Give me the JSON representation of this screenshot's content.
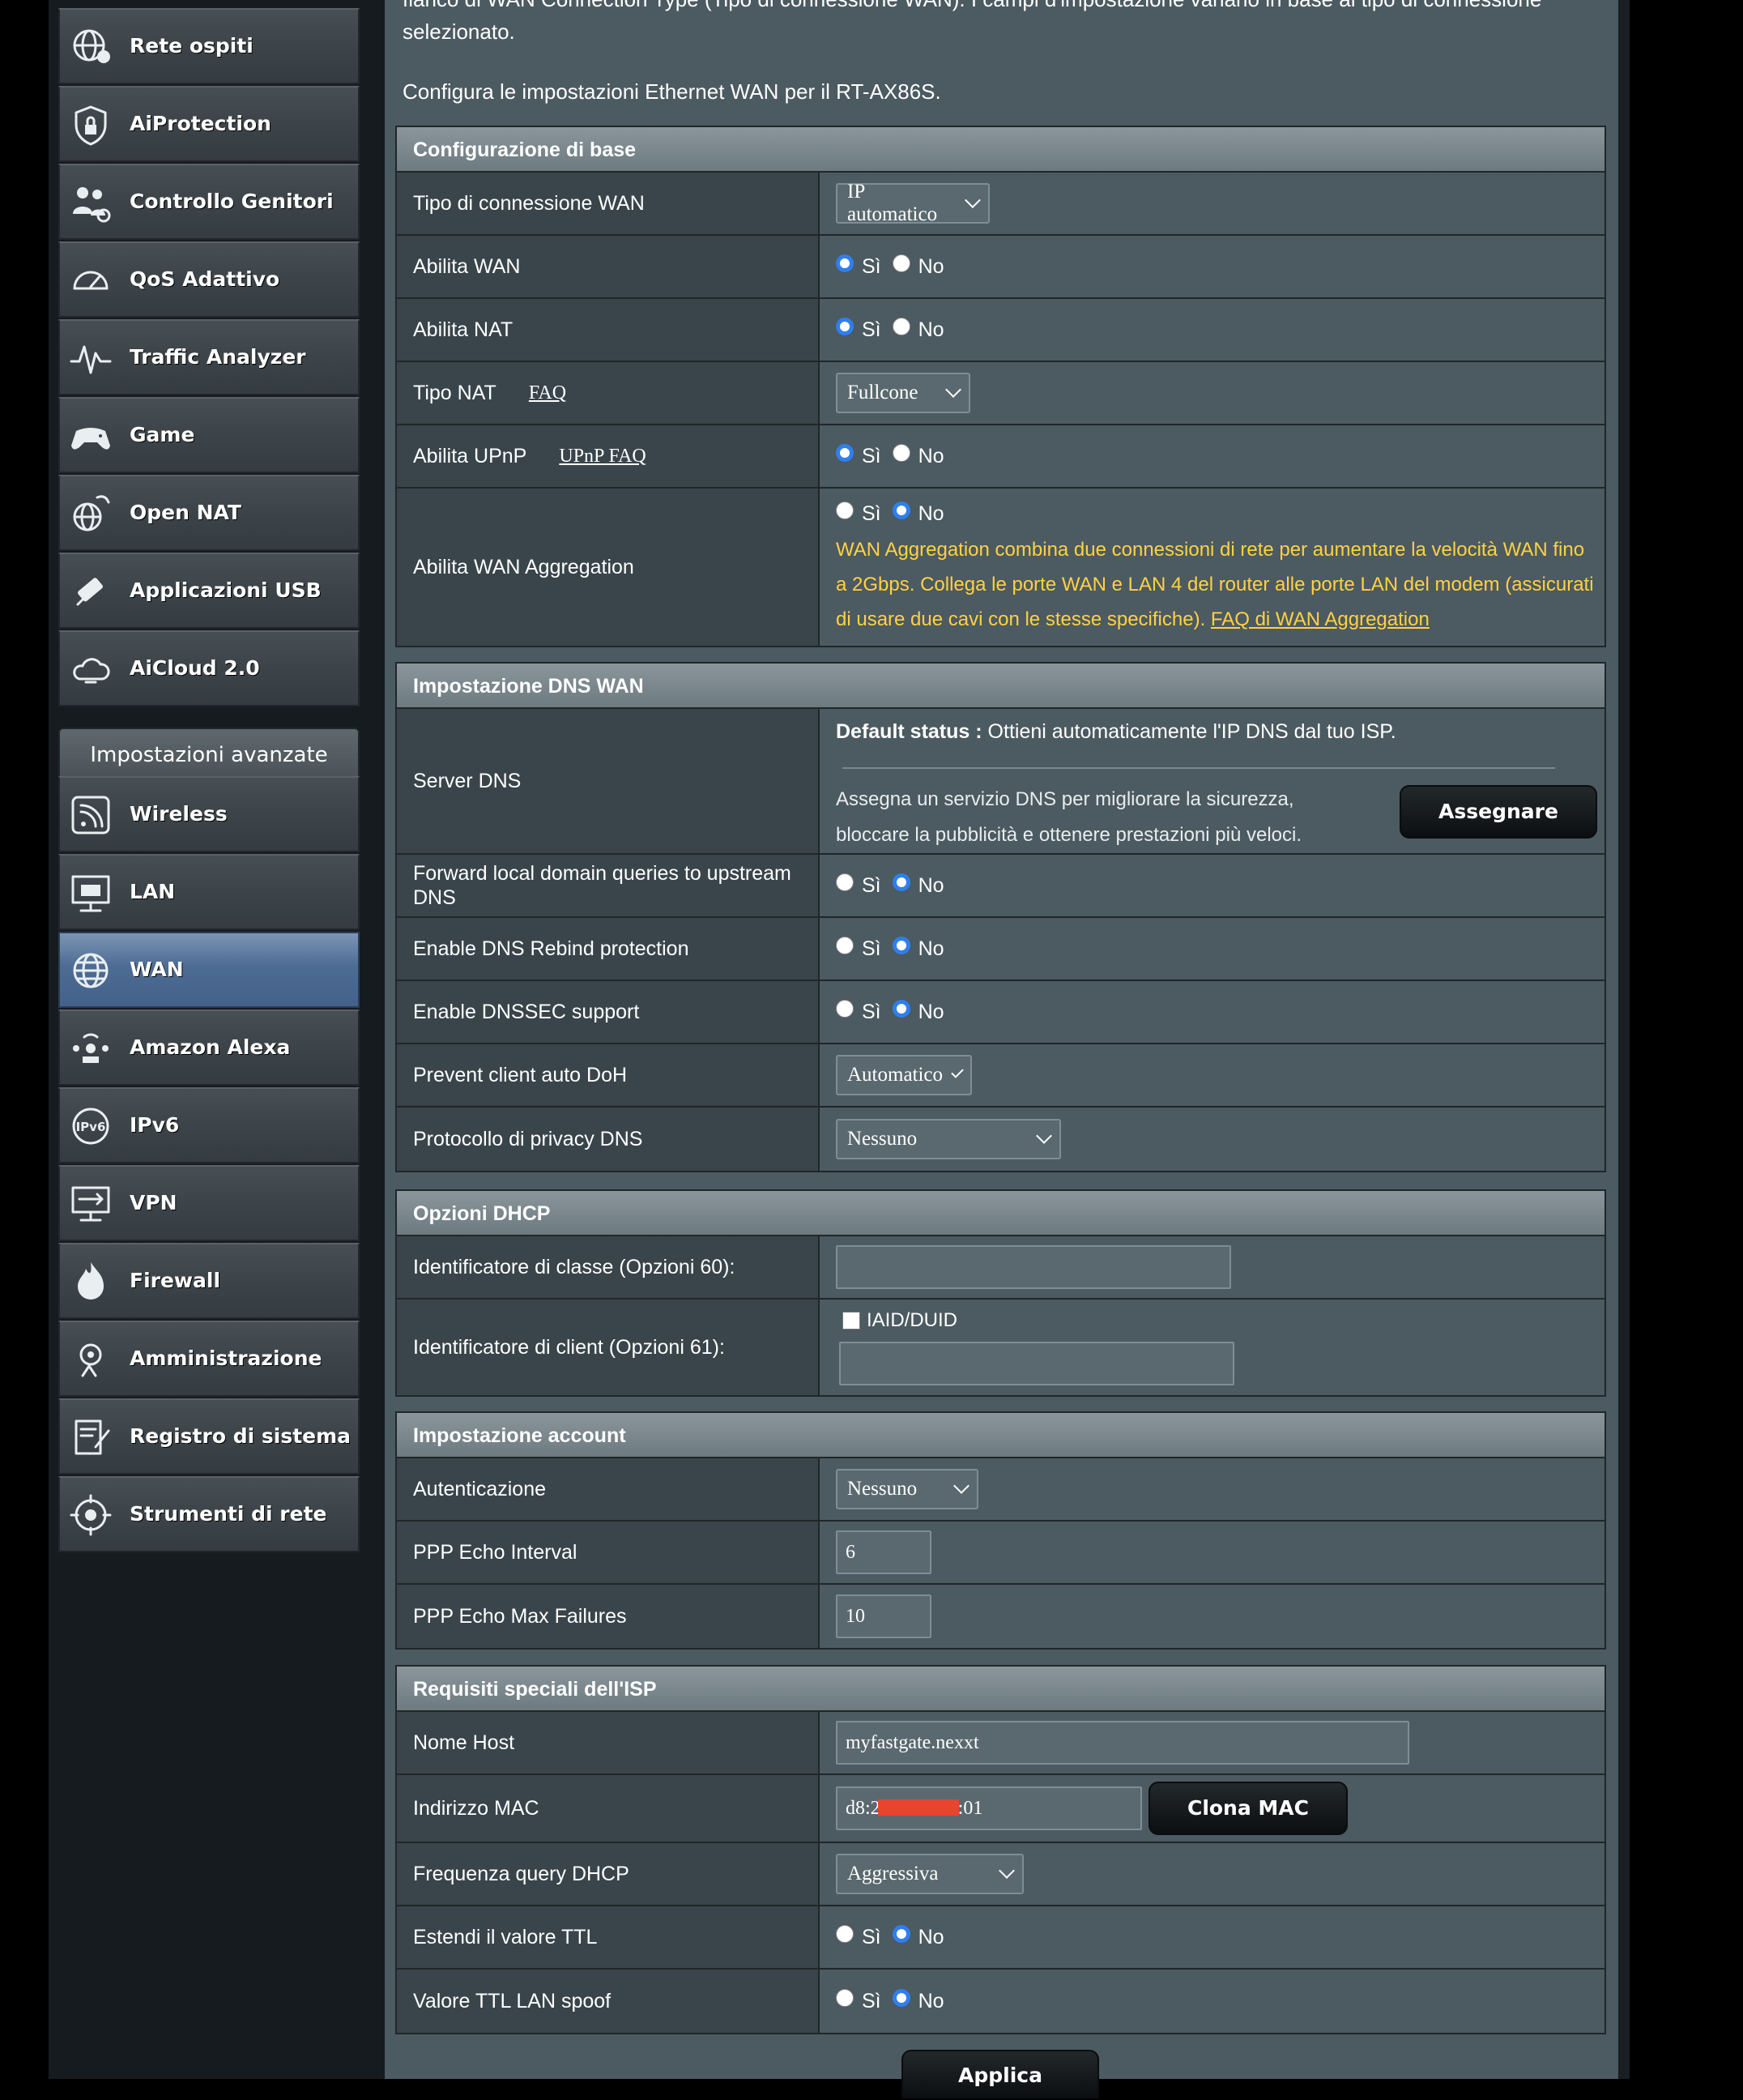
{
  "sidebar": {
    "items": [
      {
        "label": "Rete ospiti",
        "icon": "guest-network-icon"
      },
      {
        "label": "AiProtection",
        "icon": "shield-lock-icon"
      },
      {
        "label": "Controllo Genitori",
        "icon": "parental-control-icon"
      },
      {
        "label": "QoS Adattivo",
        "icon": "speedometer-icon"
      },
      {
        "label": "Traffic Analyzer",
        "icon": "traffic-analyzer-icon"
      },
      {
        "label": "Game",
        "icon": "gamepad-icon"
      },
      {
        "label": "Open NAT",
        "icon": "open-nat-icon"
      },
      {
        "label": "Applicazioni USB",
        "icon": "usb-icon"
      },
      {
        "label": "AiCloud 2.0",
        "icon": "cloud-icon"
      }
    ],
    "advanced_header": "Impostazioni avanzate",
    "advanced_items": [
      {
        "label": "Wireless",
        "icon": "wireless-icon"
      },
      {
        "label": "LAN",
        "icon": "lan-icon"
      },
      {
        "label": "WAN",
        "icon": "globe-icon",
        "active": true
      },
      {
        "label": "Amazon Alexa",
        "icon": "alexa-icon"
      },
      {
        "label": "IPv6",
        "icon": "ipv6-icon"
      },
      {
        "label": "VPN",
        "icon": "vpn-icon"
      },
      {
        "label": "Firewall",
        "icon": "firewall-icon"
      },
      {
        "label": "Amministrazione",
        "icon": "administration-icon"
      },
      {
        "label": "Registro di sistema",
        "icon": "system-log-icon"
      },
      {
        "label": "Strumenti di rete",
        "icon": "network-tools-icon"
      }
    ]
  },
  "intro": {
    "line1": "fianco di WAN Connection Type (Tipo di connessione WAN). I campi d'impostazione variano in base al tipo di connessione",
    "line2": "selezionato.",
    "line3": "Configura le impostazioni Ethernet WAN per il RT-AX86S."
  },
  "radio": {
    "yes": "Sì",
    "no": "No"
  },
  "basic": {
    "title": "Configurazione di base",
    "wan_type_label": "Tipo di connessione WAN",
    "wan_type_value": "IP automatico",
    "enable_wan_label": "Abilita WAN",
    "enable_nat_label": "Abilita NAT",
    "nat_type_label": "Tipo NAT",
    "nat_type_faq": "FAQ",
    "nat_type_value": "Fullcone",
    "upnp_label": "Abilita UPnP",
    "upnp_faq": "UPnP FAQ",
    "aggregation_label": "Abilita WAN Aggregation",
    "aggregation_note": "WAN Aggregation combina due connessioni di rete per aumentare la velocità WAN fino a 2Gbps. Collega le porte WAN e LAN 4 del router alle porte LAN del modem (assicurati di usare due cavi con le stesse specifiche).",
    "aggregation_faq": "FAQ di WAN Aggregation"
  },
  "dns": {
    "title": "Impostazione DNS WAN",
    "server_label": "Server DNS",
    "default_status_label": "Default status :",
    "default_status_value": "Ottieni automaticamente l'IP DNS dal tuo ISP.",
    "assign_text_1": "Assegna un servizio DNS per migliorare la sicurezza,",
    "assign_text_2": "bloccare la pubblicità e ottenere prestazioni più veloci.",
    "assign_button": "Assegnare",
    "forward_label": "Forward local domain queries to upstream DNS",
    "rebind_label": "Enable DNS Rebind protection",
    "dnssec_label": "Enable DNSSEC support",
    "doh_label": "Prevent client auto DoH",
    "doh_value": "Automatico",
    "privacy_label": "Protocollo di privacy DNS",
    "privacy_value": "Nessuno"
  },
  "dhcp": {
    "title": "Opzioni DHCP",
    "class_label": "Identificatore di classe (Opzioni 60):",
    "client_label": "Identificatore di client (Opzioni 61):",
    "iaid_label": "IAID/DUID"
  },
  "account": {
    "title": "Impostazione account",
    "auth_label": "Autenticazione",
    "auth_value": "Nessuno",
    "echo_interval_label": "PPP Echo Interval",
    "echo_interval_value": "6",
    "echo_fail_label": "PPP Echo Max Failures",
    "echo_fail_value": "10"
  },
  "isp": {
    "title": "Requisiti speciali dell'ISP",
    "host_label": "Nome Host",
    "host_value": "myfastgate.nexxt",
    "mac_label": "Indirizzo MAC",
    "mac_value_start": "d8:2",
    "mac_value_end": ":01",
    "clone_button": "Clona MAC",
    "dhcp_freq_label": "Frequenza query DHCP",
    "dhcp_freq_value": "Aggressiva",
    "ttl_label": "Estendi il valore TTL",
    "ttl_spoof_label": "Valore TTL LAN spoof"
  },
  "apply_button": "Applica",
  "colors": {
    "accent": "#2f7fee",
    "warning": "#ffd23f",
    "active_menu": "#4d6c94",
    "redaction": "#e8442e"
  }
}
